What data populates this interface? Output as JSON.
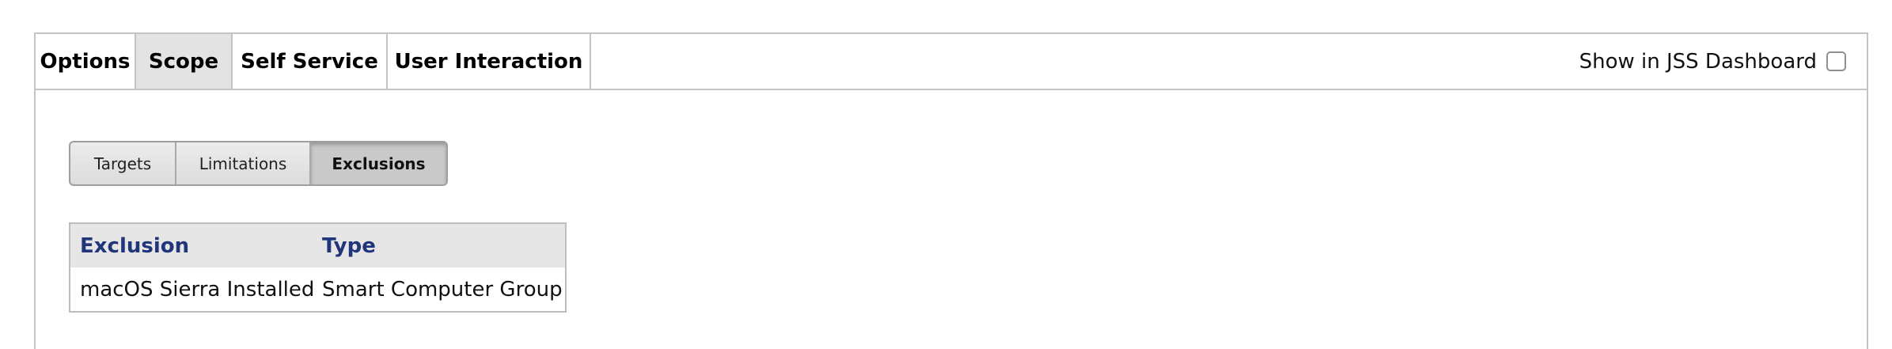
{
  "tabs": [
    {
      "label": "Options",
      "active": false
    },
    {
      "label": "Scope",
      "active": true
    },
    {
      "label": "Self Service",
      "active": false
    },
    {
      "label": "User Interaction",
      "active": false
    }
  ],
  "dashboard": {
    "label": "Show in JSS Dashboard",
    "checked": false
  },
  "scope_tabs": [
    {
      "label": "Targets",
      "active": false
    },
    {
      "label": "Limitations",
      "active": false
    },
    {
      "label": "Exclusions",
      "active": true
    }
  ],
  "exclusions_table": {
    "columns": [
      "Exclusion",
      "Type"
    ],
    "rows": [
      [
        "macOS Sierra Installed",
        "Smart Computer Group"
      ]
    ]
  },
  "colors": {
    "header_text": "#21357a",
    "active_tab_bg": "#e3e3e3",
    "border": "#c4c4c4"
  }
}
